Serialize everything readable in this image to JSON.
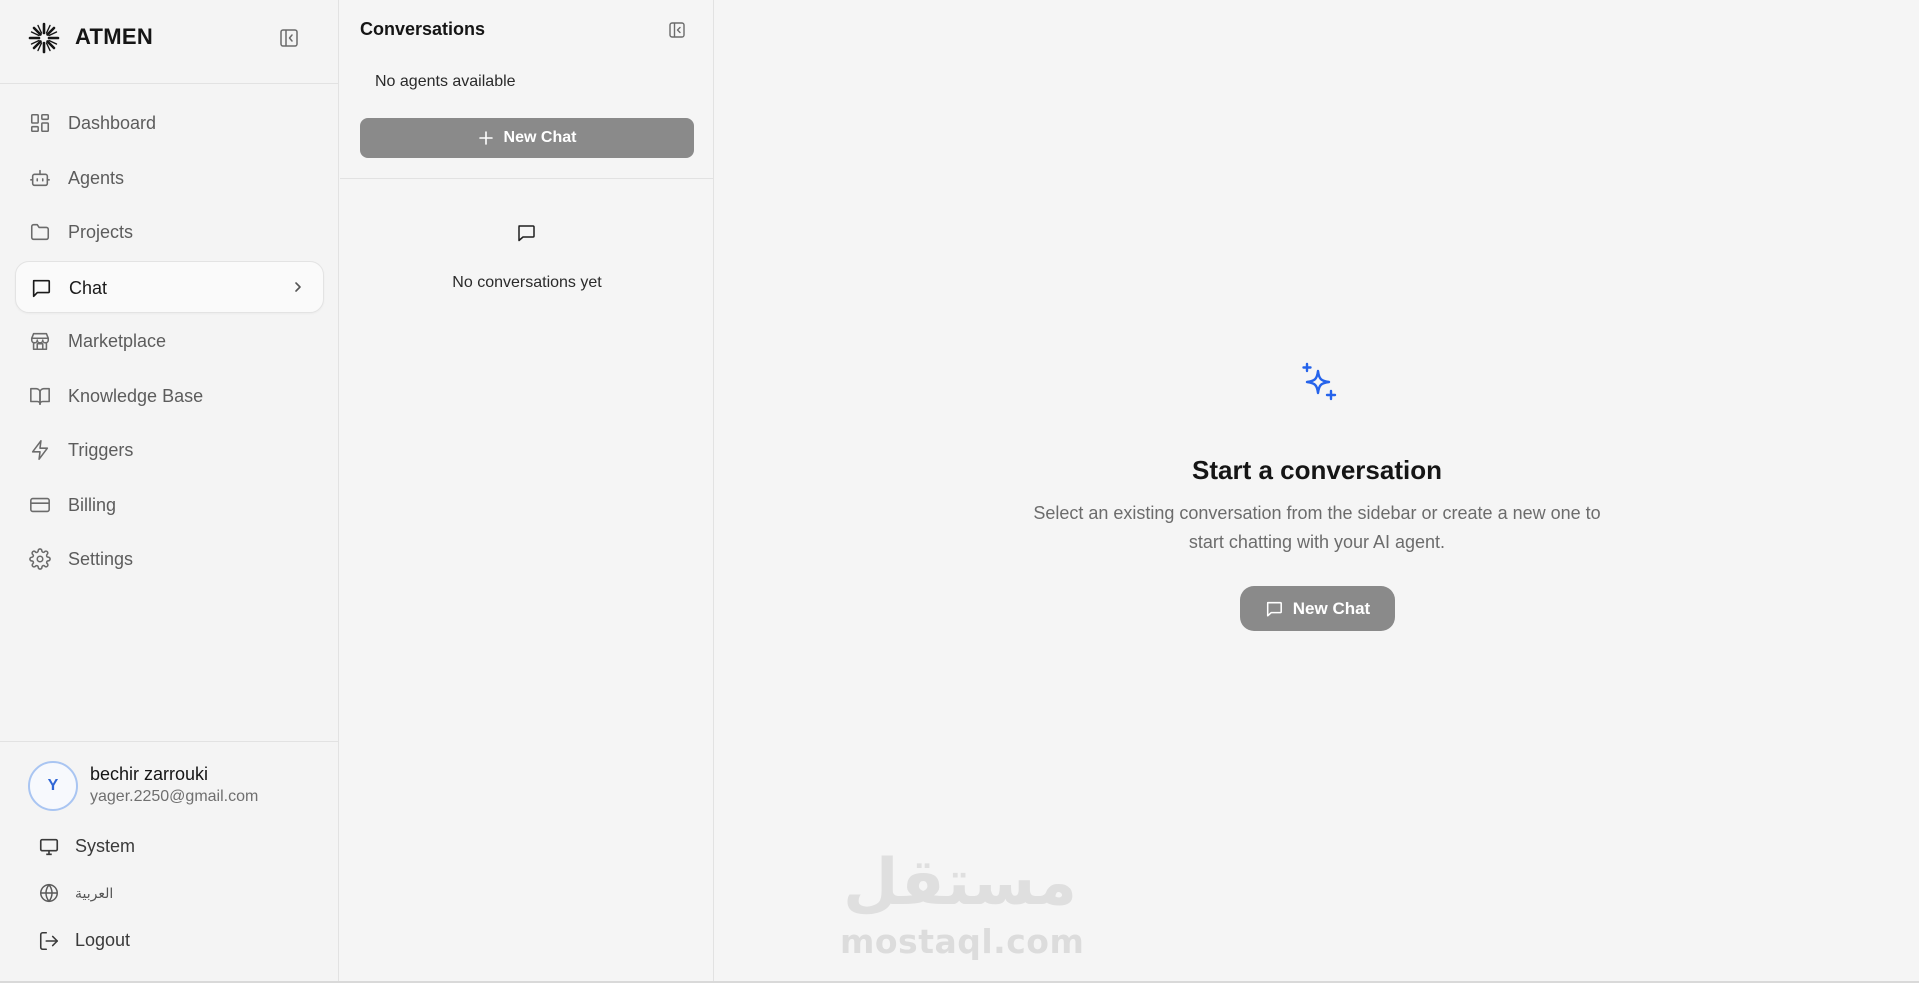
{
  "brand": {
    "name": "ATMEN",
    "logo_icon": "asterisk-burst-icon"
  },
  "sidebar": {
    "collapse_icon": "panel-collapse-icon",
    "items": [
      {
        "label": "Dashboard",
        "icon": "dashboard-grid-icon",
        "active": false
      },
      {
        "label": "Agents",
        "icon": "robot-icon",
        "active": false
      },
      {
        "label": "Projects",
        "icon": "folder-icon",
        "active": false
      },
      {
        "label": "Chat",
        "icon": "message-square-icon",
        "active": true
      },
      {
        "label": "Marketplace",
        "icon": "store-icon",
        "active": false
      },
      {
        "label": "Knowledge Base",
        "icon": "book-open-icon",
        "active": false
      },
      {
        "label": "Triggers",
        "icon": "lightning-icon",
        "active": false
      },
      {
        "label": "Billing",
        "icon": "credit-card-icon",
        "active": false
      },
      {
        "label": "Settings",
        "icon": "gear-icon",
        "active": false
      }
    ]
  },
  "user": {
    "initial": "Y",
    "name": "bechir zarrouki",
    "email": "yager.2250@gmail.com"
  },
  "utilities": {
    "theme_label": "System",
    "language_label": "العربية",
    "logout_label": "Logout"
  },
  "conversations": {
    "title": "Conversations",
    "no_agents": "No agents available",
    "new_chat_label": "New Chat",
    "empty_text": "No conversations yet"
  },
  "main": {
    "title": "Start a conversation",
    "description": "Select an existing conversation from the sidebar or create a new one to start chatting with your AI agent.",
    "new_chat_label": "New Chat",
    "accent_color": "#2563eb"
  },
  "watermark": {
    "arabic": "مستقل",
    "latin": "mostaql.com"
  }
}
